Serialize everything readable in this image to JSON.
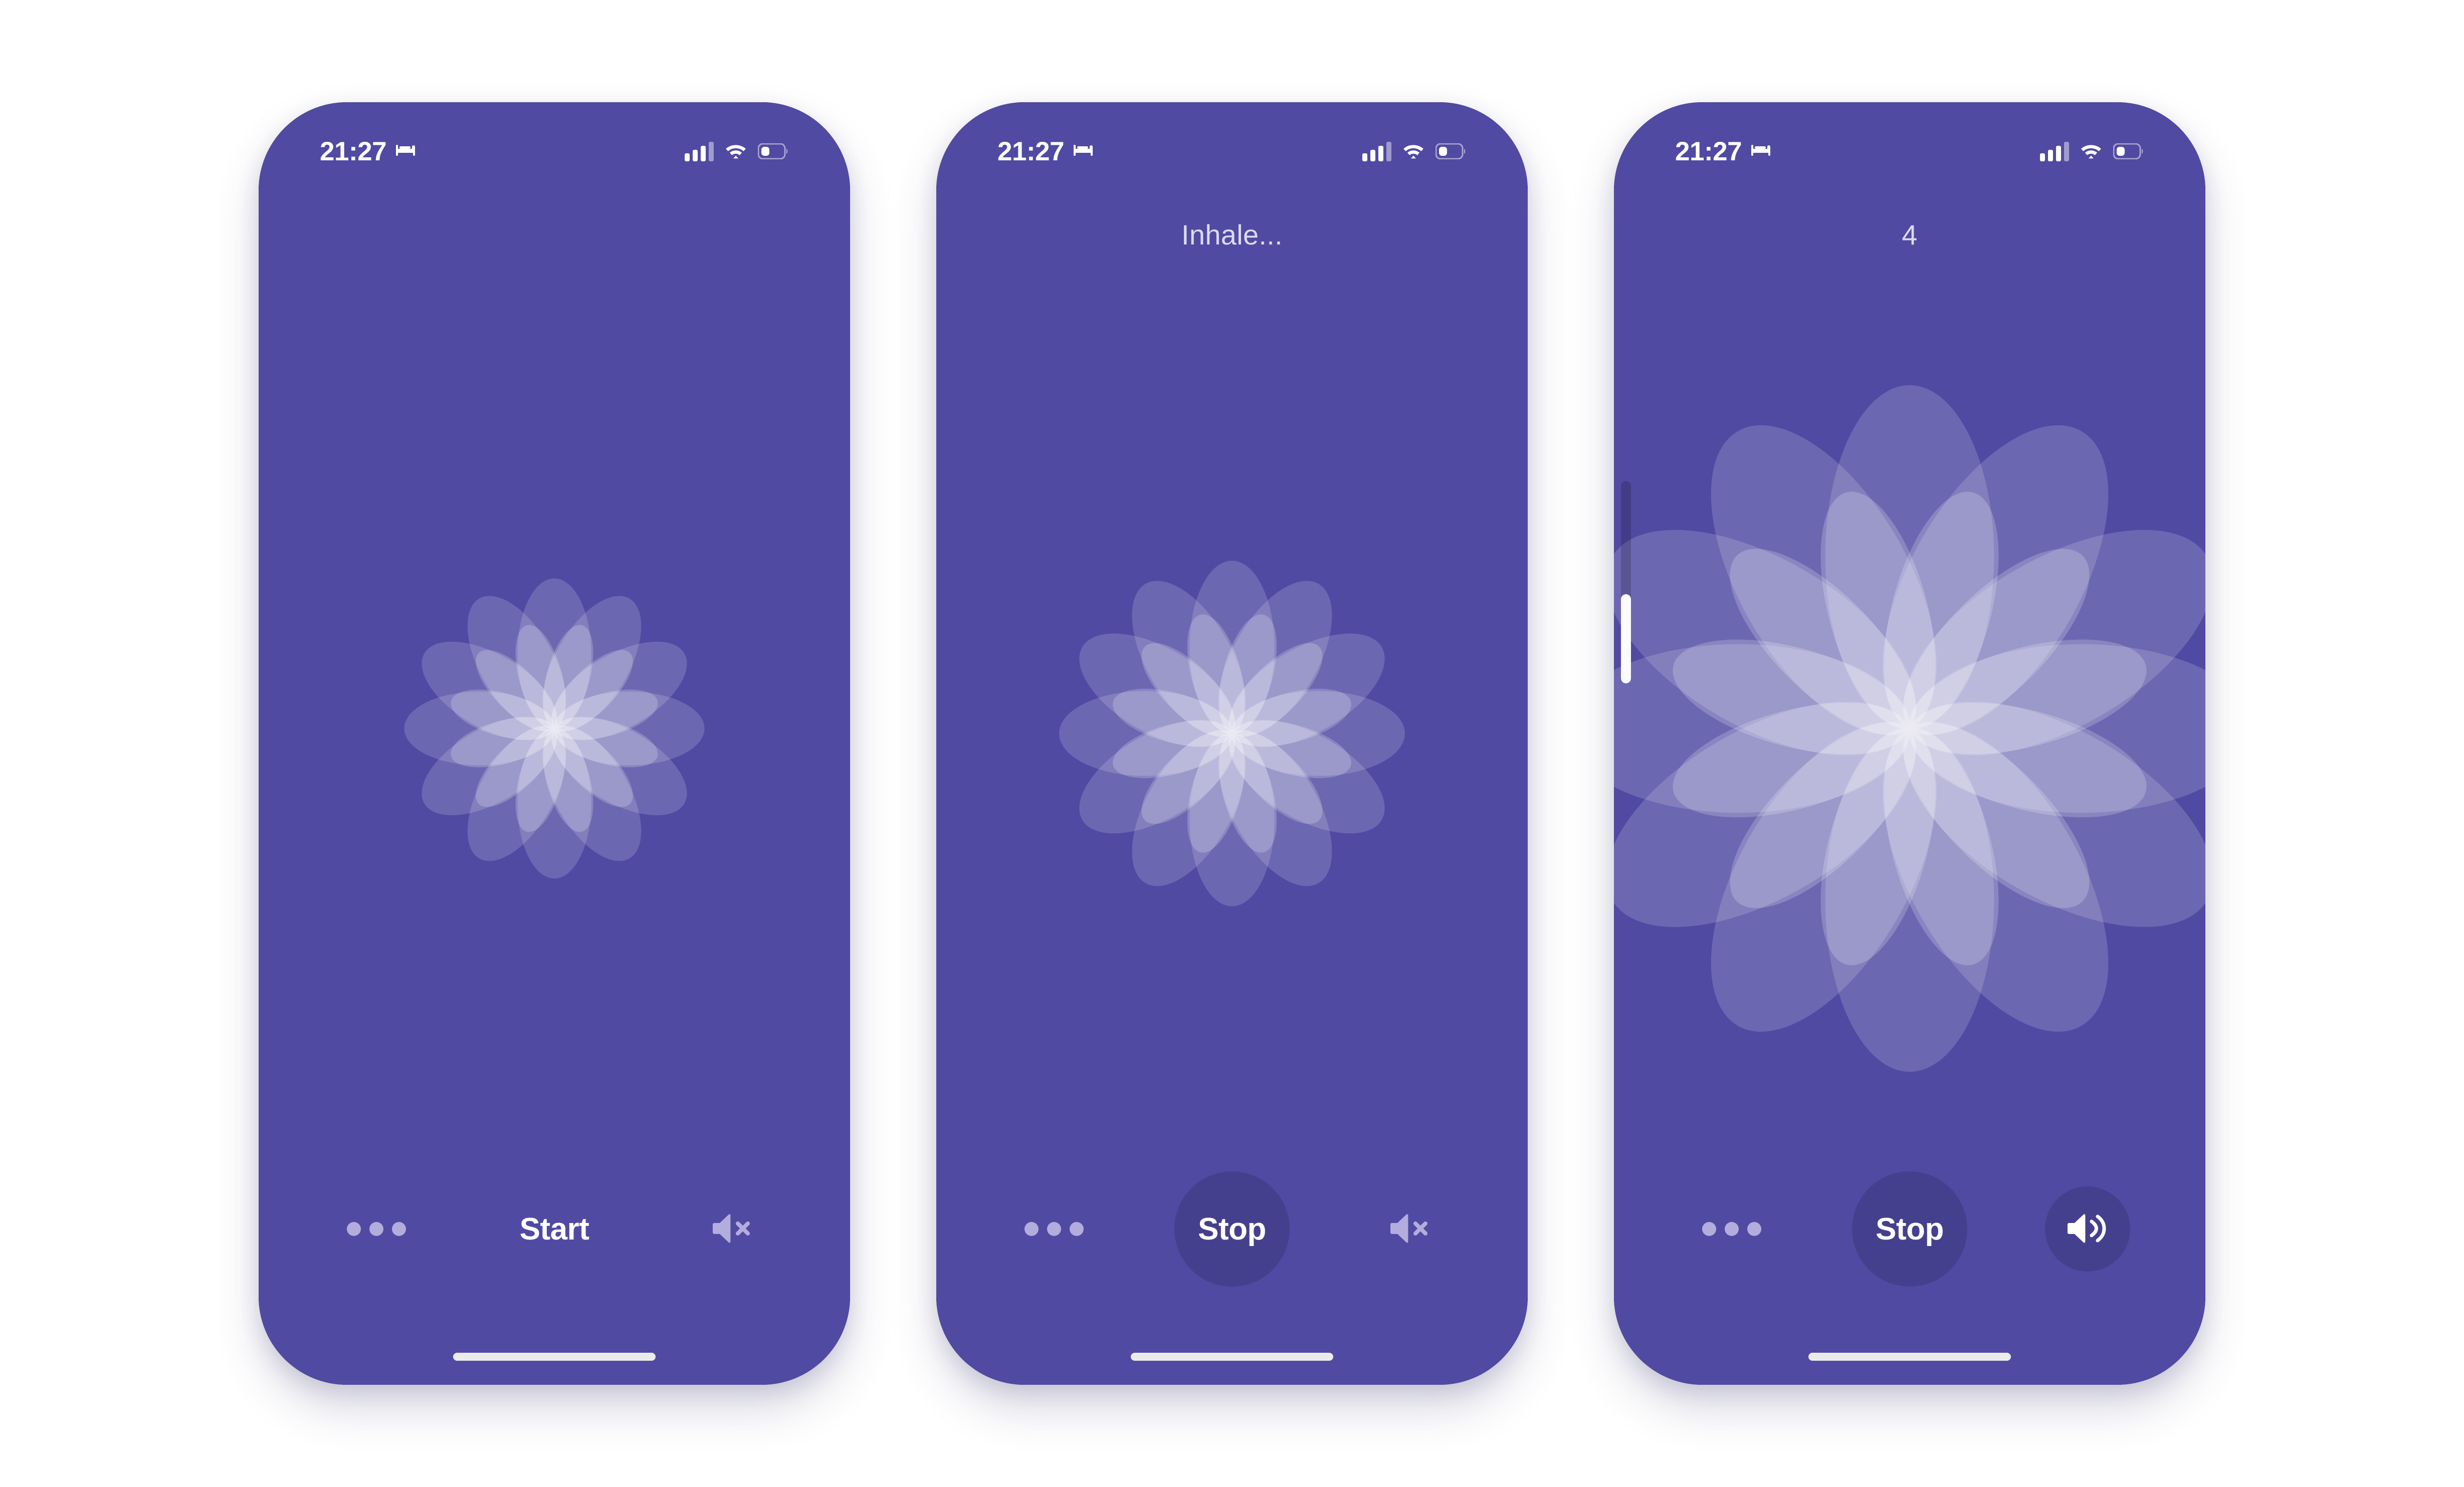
{
  "theme": {
    "page_background": "#ffffff",
    "screen_background": "#504AA3",
    "petal_color": "#FFFFFF",
    "accent_text": "#DCDAEF",
    "dots_color": "#B2ADDC",
    "home_indicator_color": "#EBEBEB"
  },
  "status_bar": {
    "time": "21:27",
    "bed_icon": "bed-icon",
    "signal_icon": "cellular-signal-icon",
    "signal_bars_filled": 3,
    "signal_bars_total": 4,
    "wifi_icon": "wifi-icon",
    "battery_icon": "battery-icon",
    "battery_level_percent": 30
  },
  "phones": [
    {
      "id": "idle",
      "phase_label": "",
      "phase_label_visible": false,
      "bloom_size": "small",
      "bloom_petals": 12,
      "menu_button": {
        "name": "more-options-button",
        "icon": "ellipsis-icon"
      },
      "primary_button": {
        "label": "Start",
        "filled": false
      },
      "sound_button": {
        "icon": "speaker-muted-icon",
        "muted": true,
        "filled": false
      },
      "side_slider_visible": false
    },
    {
      "id": "inhale",
      "phase_label": "Inhale...",
      "phase_label_visible": true,
      "bloom_size": "medium",
      "bloom_petals": 12,
      "menu_button": {
        "name": "more-options-button",
        "icon": "ellipsis-icon"
      },
      "primary_button": {
        "label": "Stop",
        "filled": true
      },
      "sound_button": {
        "icon": "speaker-muted-icon",
        "muted": true,
        "filled": false
      },
      "side_slider_visible": false
    },
    {
      "id": "hold-count",
      "phase_label": "4",
      "phase_label_visible": true,
      "bloom_size": "large",
      "bloom_petals": 12,
      "menu_button": {
        "name": "more-options-button",
        "icon": "ellipsis-icon"
      },
      "primary_button": {
        "label": "Stop",
        "filled": true
      },
      "sound_button": {
        "icon": "speaker-on-icon",
        "muted": false,
        "filled": true
      },
      "side_slider_visible": true,
      "side_slider_value_percent": 44
    }
  ]
}
